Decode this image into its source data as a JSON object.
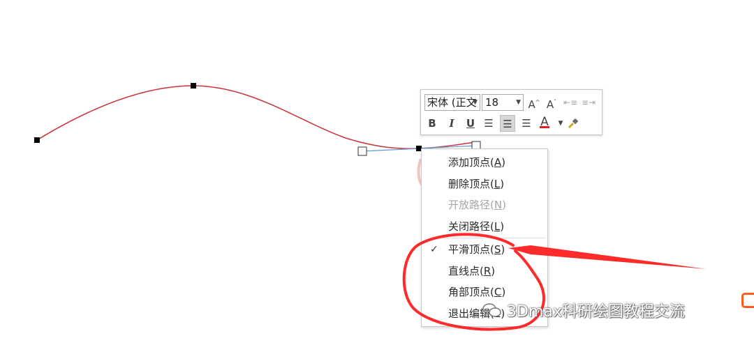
{
  "mini_toolbar": {
    "font_name": "宋体 (正文",
    "font_size": "18",
    "grow_font_icon": "A",
    "shrink_font_icon": "A",
    "bold": "B",
    "italic": "I",
    "underline": "U",
    "font_color_label": "A",
    "font_color": "#e02020",
    "center_align_active": true
  },
  "context_menu": {
    "items": [
      {
        "text": "添加顶点(",
        "key": "A",
        "suffix": ")",
        "enabled": true,
        "checked": false
      },
      {
        "text": "删除顶点(",
        "key": "L",
        "suffix": ")",
        "enabled": true,
        "checked": false
      },
      {
        "text": "开放路径(",
        "key": "N",
        "suffix": ")",
        "enabled": false,
        "checked": false
      },
      {
        "text": "关闭路径(",
        "key": "L",
        "suffix": ")",
        "enabled": true,
        "checked": false
      },
      {
        "text": "平滑顶点(",
        "key": "S",
        "suffix": ")",
        "enabled": true,
        "checked": true
      },
      {
        "text": "直线点(",
        "key": "R",
        "suffix": ")",
        "enabled": true,
        "checked": false
      },
      {
        "text": "角部顶点(",
        "key": "C",
        "suffix": ")",
        "enabled": true,
        "checked": false
      },
      {
        "text": "退出编辑",
        "key": "",
        "suffix": "(E)",
        "enabled": true,
        "checked": false
      }
    ],
    "check_mark": "✓"
  },
  "watermark": {
    "text": "3Dmax科研绘图教程交流"
  },
  "colors": {
    "curve": "#c8333a",
    "tangent_line": "#5b9bd5",
    "annotation": "#ff2a2a",
    "menu_text": "#2a2a2a",
    "disabled_text": "#a6a6a6"
  }
}
